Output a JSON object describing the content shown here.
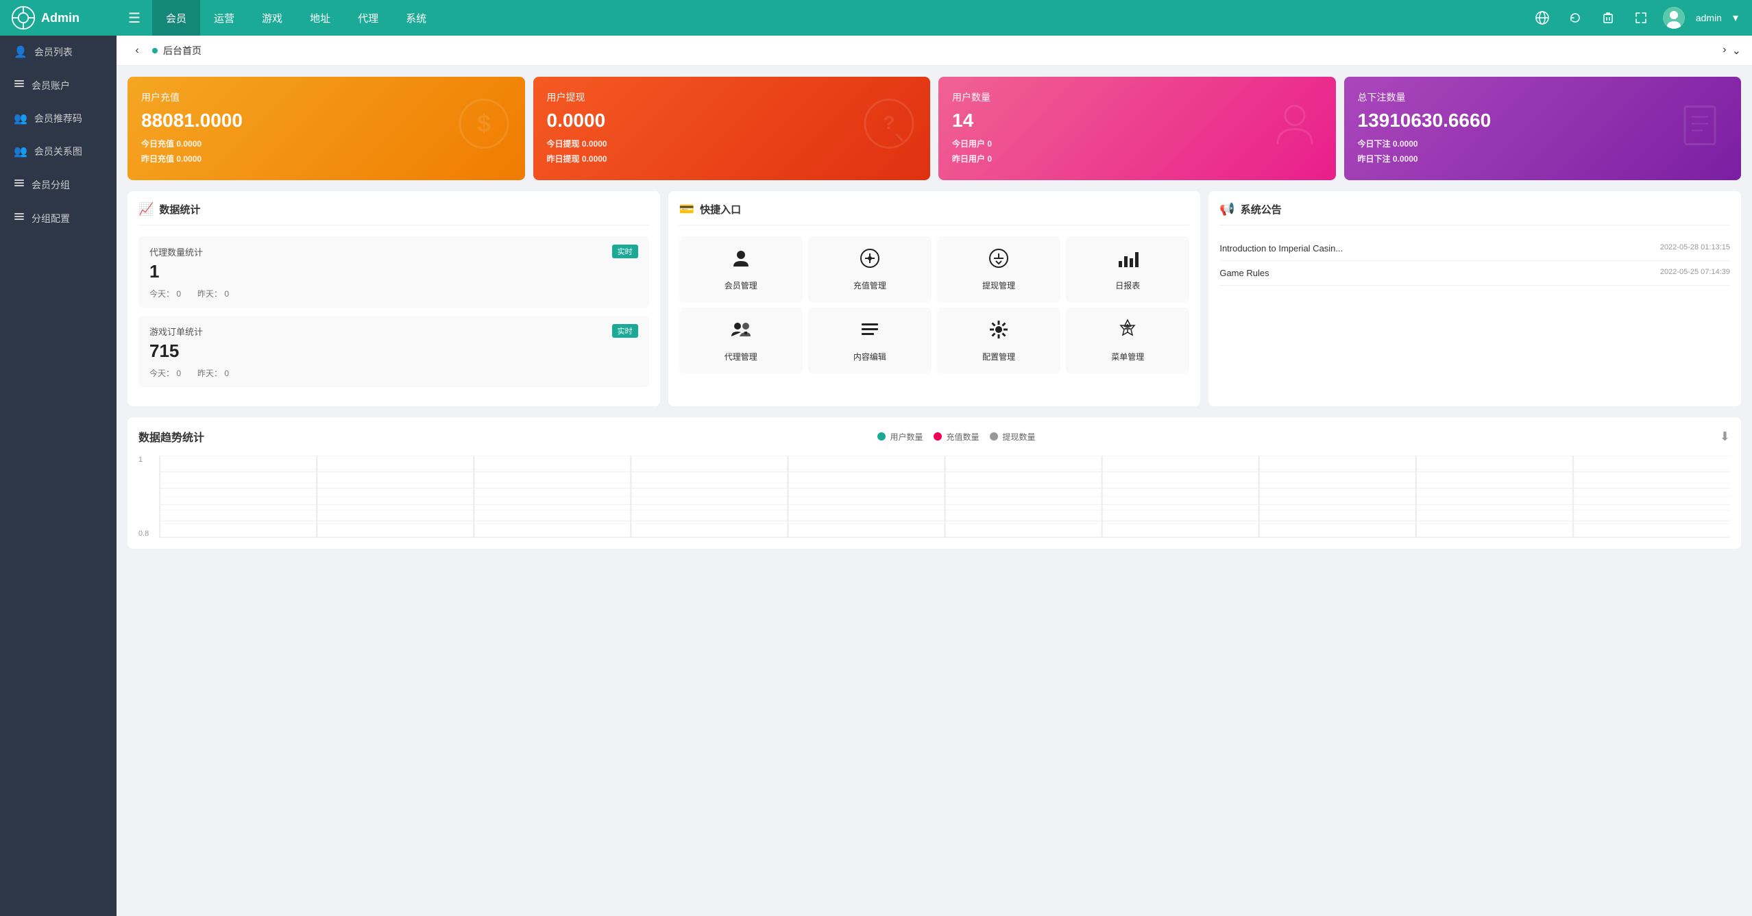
{
  "app": {
    "logo_text": "Admin",
    "admin_name": "admin"
  },
  "nav": {
    "toggle_icon": "≡",
    "items": [
      {
        "label": "会员",
        "active": true
      },
      {
        "label": "运营"
      },
      {
        "label": "游戏"
      },
      {
        "label": "地址"
      },
      {
        "label": "代理"
      },
      {
        "label": "系统"
      }
    ],
    "right_icons": [
      "globe",
      "refresh",
      "delete",
      "fullscreen"
    ]
  },
  "sidebar": {
    "items": [
      {
        "label": "会员列表",
        "icon": "👤"
      },
      {
        "label": "会员账户",
        "icon": "≡"
      },
      {
        "label": "会员推荐码",
        "icon": "👥"
      },
      {
        "label": "会员关系图",
        "icon": "👥"
      },
      {
        "label": "会员分组",
        "icon": "≡"
      },
      {
        "label": "分组配置",
        "icon": "≡"
      }
    ]
  },
  "breadcrumb": {
    "text": "后台首页"
  },
  "stat_cards": [
    {
      "id": "recharge",
      "title": "用户充值",
      "value": "88081.0000",
      "sub1_label": "今日充值",
      "sub1_value": "0.0000",
      "sub2_label": "昨日充值",
      "sub2_value": "0.0000",
      "icon": "$",
      "color": "orange"
    },
    {
      "id": "withdraw",
      "title": "用户提现",
      "value": "0.0000",
      "sub1_label": "今日提现",
      "sub1_value": "0.0000",
      "sub2_label": "昨日提现",
      "sub2_value": "0.0000",
      "icon": "?",
      "color": "red"
    },
    {
      "id": "users",
      "title": "用户数量",
      "value": "14",
      "sub1_label": "今日用户",
      "sub1_value": "0",
      "sub2_label": "昨日用户",
      "sub2_value": "0",
      "icon": "👤",
      "color": "pink"
    },
    {
      "id": "bets",
      "title": "总下注数量",
      "value": "13910630.6660",
      "sub1_label": "今日下注",
      "sub1_value": "0.0000",
      "sub2_label": "昨日下注",
      "sub2_value": "0.0000",
      "icon": "📖",
      "color": "purple"
    }
  ],
  "data_stats": {
    "panel_title": "数据统计",
    "items": [
      {
        "label": "代理数量统计",
        "badge": "实时",
        "value": "1",
        "today_label": "今天：",
        "today_value": "0",
        "yesterday_label": "昨天：",
        "yesterday_value": "0"
      },
      {
        "label": "游戏订单统计",
        "badge": "实时",
        "value": "715",
        "today_label": "今天：",
        "today_value": "0",
        "yesterday_label": "昨天：",
        "yesterday_value": "0"
      }
    ]
  },
  "quick_entry": {
    "panel_title": "快捷入口",
    "items": [
      {
        "label": "会员管理",
        "icon": "👤"
      },
      {
        "label": "充值管理",
        "icon": "⊕"
      },
      {
        "label": "提现管理",
        "icon": "⊕"
      },
      {
        "label": "日报表",
        "icon": "📊"
      },
      {
        "label": "代理管理",
        "icon": "👥"
      },
      {
        "label": "内容编辑",
        "icon": "≡"
      },
      {
        "label": "配置管理",
        "icon": "✳"
      },
      {
        "label": "菜单管理",
        "icon": "🌲"
      }
    ]
  },
  "system_notice": {
    "panel_title": "系统公告",
    "items": [
      {
        "text": "Introduction to Imperial Casin...",
        "date": "2022-05-28 01:13:15"
      },
      {
        "text": "Game Rules",
        "date": "2022-05-25 07:14:39"
      }
    ]
  },
  "trend": {
    "title": "数据趋势统计",
    "legend": [
      {
        "label": "用户数量",
        "color": "teal"
      },
      {
        "label": "充值数量",
        "color": "red"
      },
      {
        "label": "提现数量",
        "color": "gray"
      }
    ],
    "y_labels": [
      "1",
      "0.8"
    ],
    "download_icon": "⬇"
  }
}
